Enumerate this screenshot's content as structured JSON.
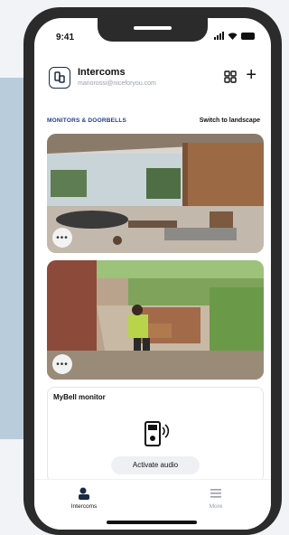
{
  "status": {
    "time": "9:41"
  },
  "header": {
    "title": "Intercoms",
    "subtitle": "mariorossi@niceforyou.com",
    "add_label": "+"
  },
  "section": {
    "label": "MONITORS & DOORBELLS",
    "switch_label": "Switch to landscape"
  },
  "cameras": [
    {
      "more_label": "•••"
    },
    {
      "more_label": "•••"
    }
  ],
  "monitor_card": {
    "title": "MyBell monitor",
    "button_label": "Activate audio"
  },
  "tabs": [
    {
      "label": "Intercoms",
      "active": true
    },
    {
      "label": "More",
      "active": false
    }
  ],
  "colors": {
    "accent": "#1f3d8a",
    "inactive_tab": "#9aa0a8"
  }
}
